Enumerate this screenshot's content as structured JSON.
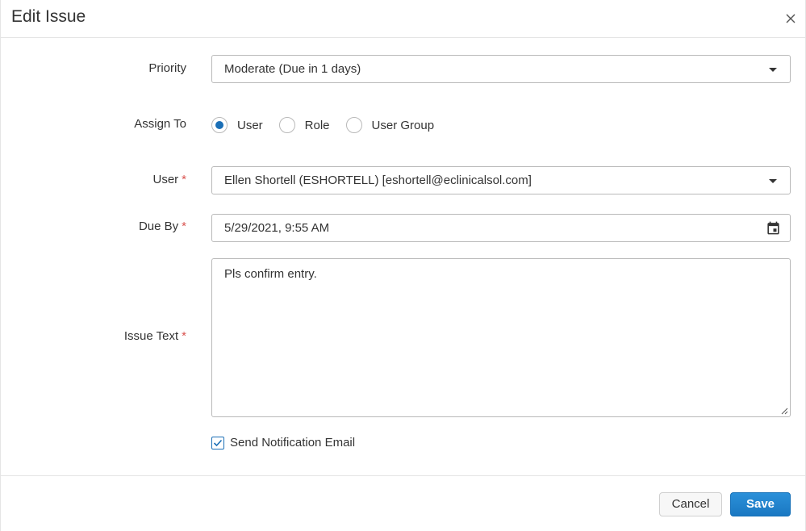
{
  "dialog": {
    "title": "Edit Issue"
  },
  "form": {
    "priority": {
      "label": "Priority",
      "value": "Moderate (Due in 1 days)"
    },
    "assign_to": {
      "label": "Assign To",
      "options": [
        "User",
        "Role",
        "User Group"
      ],
      "selected": "User"
    },
    "user": {
      "label": "User",
      "required_mark": "*",
      "value": "Ellen Shortell (ESHORTELL) [eshortell@eclinicalsol.com]"
    },
    "due_by": {
      "label": "Due By",
      "required_mark": "*",
      "value": "5/29/2021, 9:55 AM"
    },
    "issue_text": {
      "label": "Issue Text",
      "required_mark": "*",
      "value": "Pls confirm entry."
    },
    "send_notification": {
      "label": "Send Notification Email",
      "checked": true
    }
  },
  "footer": {
    "cancel_label": "Cancel",
    "save_label": "Save"
  },
  "colors": {
    "accent": "#1b6fb6",
    "required": "#d9534f",
    "save_button": "#1a78c2"
  },
  "icons": {
    "close": "close-icon",
    "dropdown": "chevron-down-icon",
    "calendar": "calendar-icon",
    "resize": "resize-handle-icon",
    "check": "checkmark-icon"
  }
}
